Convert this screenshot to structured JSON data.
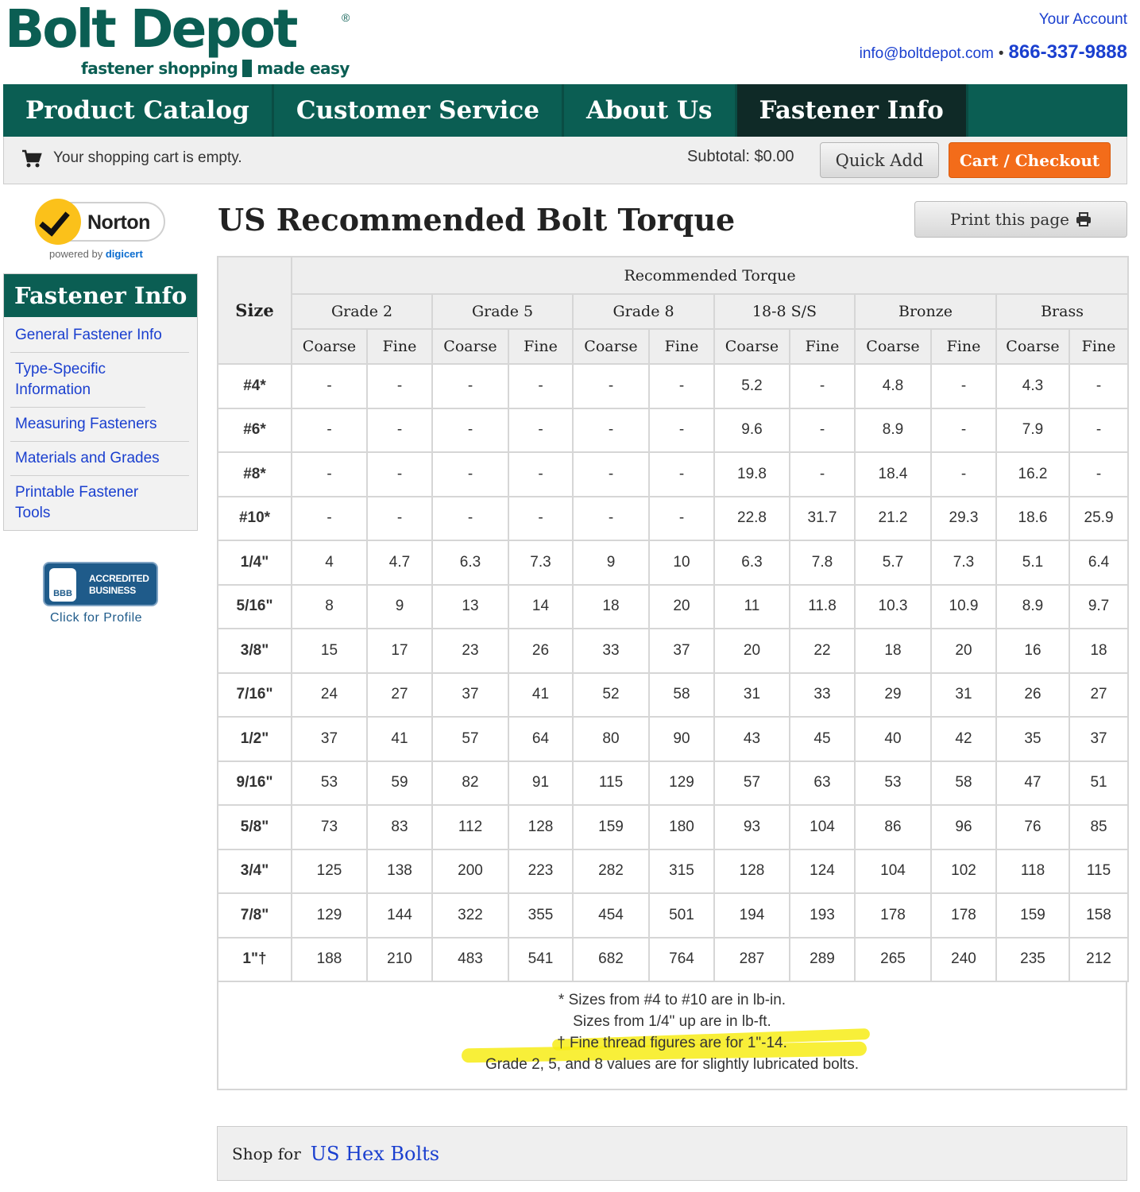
{
  "header": {
    "logo_word": "Bolt Depot",
    "logo_reg": "®",
    "logo_tag_left": "fastener shopping",
    "logo_tag_right": "made easy",
    "account_link": "Your Account",
    "email": "info@boltdepot.com",
    "separator": "•",
    "phone": "866-337-9888"
  },
  "nav": {
    "items": [
      "Product Catalog",
      "Customer Service",
      "About Us",
      "Fastener Info"
    ],
    "active": "Fastener Info"
  },
  "cart": {
    "status": "Your shopping cart is empty.",
    "subtotal": "Subtotal: $0.00",
    "quick_add": "Quick Add",
    "checkout": "Cart / Checkout"
  },
  "sidebar": {
    "norton_name": "Norton",
    "norton_powered_prefix": "powered by",
    "norton_powered_brand": "digicert",
    "heading": "Fastener Info",
    "links": [
      "General Fastener Info",
      "Type-Specific Information",
      "Measuring Fasteners",
      "Materials and Grades",
      "Printable Fastener Tools"
    ],
    "bbb_seal": "BBB",
    "bbb_line1": "ACCREDITED",
    "bbb_line2": "BUSINESS",
    "bbb_click": "Click for Profile"
  },
  "page": {
    "title": "US Recommended Bolt Torque",
    "print_label": "Print this page"
  },
  "table": {
    "size_header": "Size",
    "group_header": "Recommended Torque",
    "materials": [
      "Grade 2",
      "Grade 5",
      "Grade 8",
      "18-8 S/S",
      "Bronze",
      "Brass"
    ],
    "thread_labels": [
      "Coarse",
      "Fine"
    ],
    "rows": [
      {
        "size": "#4*",
        "values": [
          "-",
          "-",
          "-",
          "-",
          "-",
          "-",
          "5.2",
          "-",
          "4.8",
          "-",
          "4.3",
          "-"
        ]
      },
      {
        "size": "#6*",
        "values": [
          "-",
          "-",
          "-",
          "-",
          "-",
          "-",
          "9.6",
          "-",
          "8.9",
          "-",
          "7.9",
          "-"
        ]
      },
      {
        "size": "#8*",
        "values": [
          "-",
          "-",
          "-",
          "-",
          "-",
          "-",
          "19.8",
          "-",
          "18.4",
          "-",
          "16.2",
          "-"
        ]
      },
      {
        "size": "#10*",
        "values": [
          "-",
          "-",
          "-",
          "-",
          "-",
          "-",
          "22.8",
          "31.7",
          "21.2",
          "29.3",
          "18.6",
          "25.9"
        ]
      },
      {
        "size": "1/4\"",
        "values": [
          "4",
          "4.7",
          "6.3",
          "7.3",
          "9",
          "10",
          "6.3",
          "7.8",
          "5.7",
          "7.3",
          "5.1",
          "6.4"
        ]
      },
      {
        "size": "5/16\"",
        "values": [
          "8",
          "9",
          "13",
          "14",
          "18",
          "20",
          "11",
          "11.8",
          "10.3",
          "10.9",
          "8.9",
          "9.7"
        ]
      },
      {
        "size": "3/8\"",
        "values": [
          "15",
          "17",
          "23",
          "26",
          "33",
          "37",
          "20",
          "22",
          "18",
          "20",
          "16",
          "18"
        ]
      },
      {
        "size": "7/16\"",
        "values": [
          "24",
          "27",
          "37",
          "41",
          "52",
          "58",
          "31",
          "33",
          "29",
          "31",
          "26",
          "27"
        ]
      },
      {
        "size": "1/2\"",
        "values": [
          "37",
          "41",
          "57",
          "64",
          "80",
          "90",
          "43",
          "45",
          "40",
          "42",
          "35",
          "37"
        ]
      },
      {
        "size": "9/16\"",
        "values": [
          "53",
          "59",
          "82",
          "91",
          "115",
          "129",
          "57",
          "63",
          "53",
          "58",
          "47",
          "51"
        ]
      },
      {
        "size": "5/8\"",
        "values": [
          "73",
          "83",
          "112",
          "128",
          "159",
          "180",
          "93",
          "104",
          "86",
          "96",
          "76",
          "85"
        ]
      },
      {
        "size": "3/4\"",
        "values": [
          "125",
          "138",
          "200",
          "223",
          "282",
          "315",
          "128",
          "124",
          "104",
          "102",
          "118",
          "115"
        ]
      },
      {
        "size": "7/8\"",
        "values": [
          "129",
          "144",
          "322",
          "355",
          "454",
          "501",
          "194",
          "193",
          "178",
          "178",
          "159",
          "158"
        ]
      },
      {
        "size": "1\"†",
        "values": [
          "188",
          "210",
          "483",
          "541",
          "682",
          "764",
          "287",
          "289",
          "265",
          "240",
          "235",
          "212"
        ]
      }
    ],
    "notes": [
      "* Sizes from #4 to #10 are in lb-in.",
      "Sizes from 1/4\" up are in lb-ft.",
      "† Fine thread figures are for 1\"-14.",
      "Grade 2, 5, and 8 values are for slightly lubricated bolts."
    ],
    "highlight_color": "#f7ec16"
  },
  "shop": {
    "prefix": "Shop for",
    "link": "US Hex Bolts"
  },
  "colors": {
    "brand_green": "#0b5e53",
    "active_nav": "#0f2a27",
    "link_blue": "#1a3fcf",
    "checkout_orange": "#f36c1a"
  }
}
